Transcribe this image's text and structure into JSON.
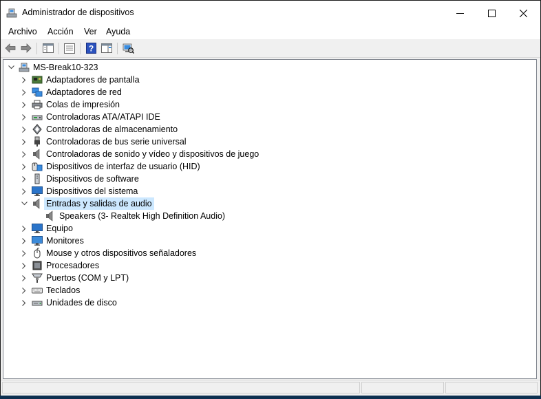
{
  "window": {
    "title": "Administrador de dispositivos"
  },
  "menu": [
    "Archivo",
    "Acción",
    "Ver",
    "Ayuda"
  ],
  "tree": {
    "root": "MS-Break10-323",
    "categories": [
      "Adaptadores de pantalla",
      "Adaptadores de red",
      "Colas de impresión",
      "Controladoras ATA/ATAPI IDE",
      "Controladoras de almacenamiento",
      "Controladoras de bus serie universal",
      "Controladoras de sonido y vídeo y dispositivos de juego",
      "Dispositivos de interfaz de usuario (HID)",
      "Dispositivos de software",
      "Dispositivos del sistema",
      "Entradas y salidas de audio",
      "Speakers (3- Realtek High Definition Audio)",
      "Equipo",
      "Monitores",
      "Mouse y otros dispositivos señaladores",
      "Procesadores",
      "Puertos (COM y LPT)",
      "Teclados",
      "Unidades de disco"
    ]
  },
  "colors": {
    "selection": "#cce8ff",
    "icon_blue": "#2b74c9",
    "desktop": "#0d3050"
  }
}
